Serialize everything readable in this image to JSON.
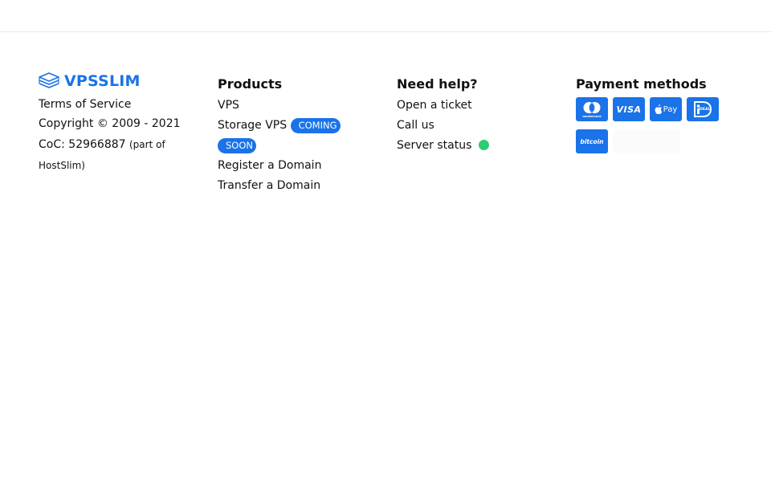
{
  "brand": {
    "logo_text": "VPSSLIM",
    "accent_color": "#1a73e8"
  },
  "about": {
    "terms": "Terms of Service",
    "copyright": "Copyright © 2009 - 2021",
    "coc": "CoC: 52966887",
    "coc_note": "(part of HostSlim)"
  },
  "products": {
    "heading": "Products",
    "items": [
      {
        "label": "VPS"
      },
      {
        "label": "Storage VPS",
        "badge": "COMING SOON"
      },
      {
        "label": "Register a Domain"
      },
      {
        "label": "Transfer a Domain"
      }
    ]
  },
  "help": {
    "heading": "Need help?",
    "items": [
      {
        "label": "Open a ticket"
      },
      {
        "label": "Call us"
      },
      {
        "label": "Server status"
      }
    ],
    "status_color": "#2ecc71"
  },
  "payments": {
    "heading": "Payment methods",
    "methods": [
      {
        "icon": "mastercard-icon",
        "label": "mastercard"
      },
      {
        "icon": "visa-icon",
        "label": "VISA"
      },
      {
        "icon": "apple-pay-icon",
        "label": "Pay"
      },
      {
        "icon": "ideal-icon",
        "label": "iDEAL"
      },
      {
        "icon": "bitcoin-icon",
        "label": "bitcoin"
      }
    ]
  }
}
